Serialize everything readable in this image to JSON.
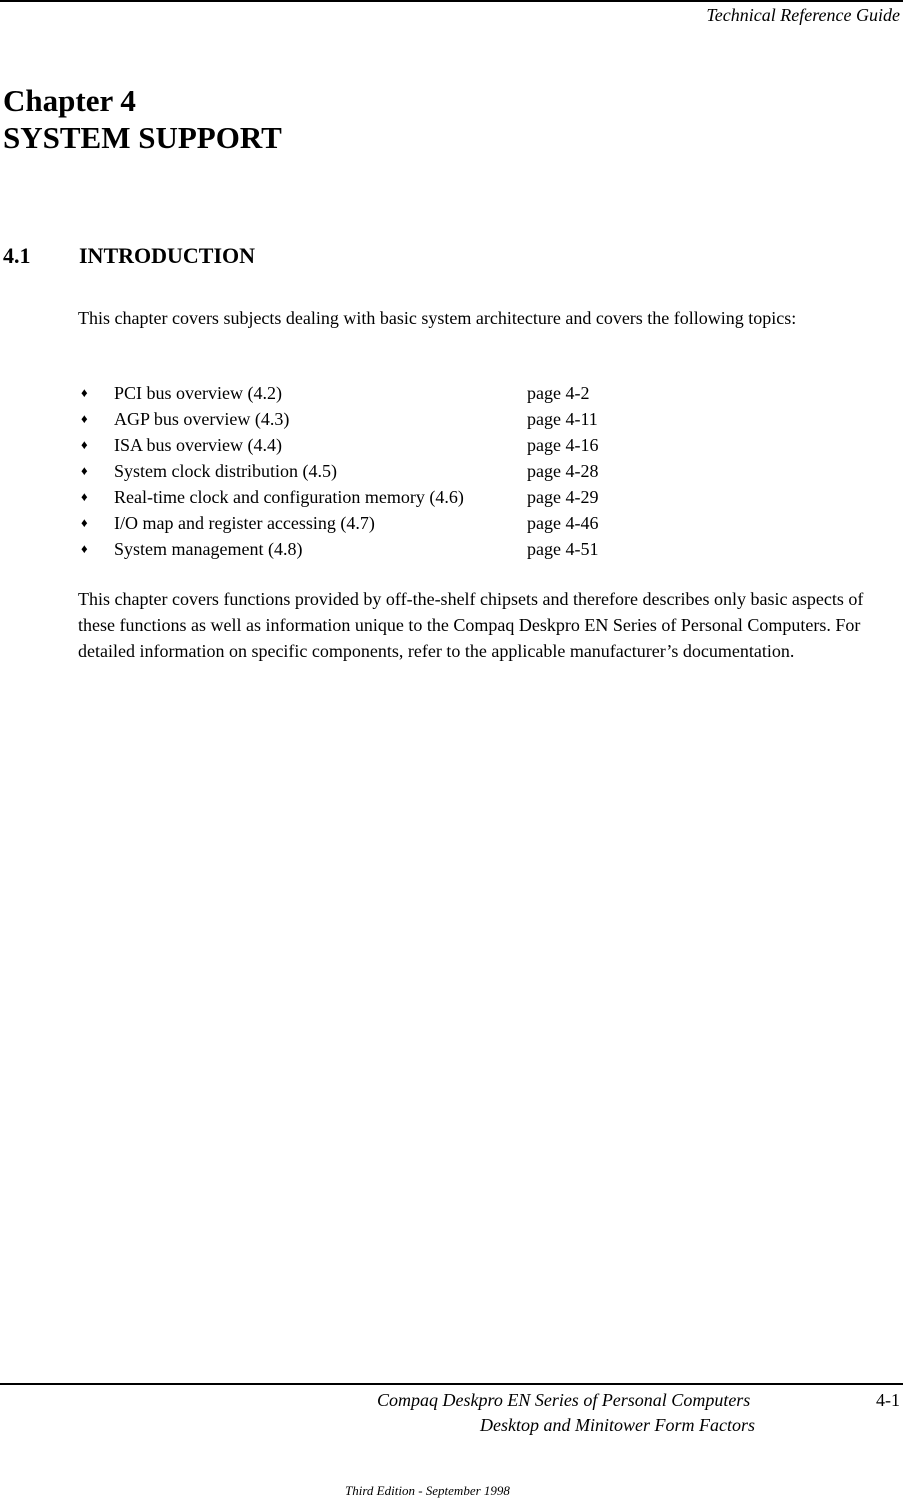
{
  "header": {
    "title": "Technical Reference Guide"
  },
  "chapter": {
    "line1": "Chapter 4",
    "line2": "SYSTEM SUPPORT"
  },
  "section": {
    "number": "4.1",
    "title": "INTRODUCTION",
    "intro": "This chapter covers subjects dealing with basic system architecture and covers the following topics:",
    "topics": [
      {
        "bullet": "♦",
        "label": "PCI bus overview (4.2)",
        "page": "page 4-2"
      },
      {
        "bullet": "♦",
        "label": "AGP bus overview (4.3)",
        "page": "page 4-11"
      },
      {
        "bullet": "♦",
        "label": "ISA bus overview (4.4)",
        "page": "page 4-16"
      },
      {
        "bullet": "♦",
        "label": "System clock distribution (4.5)",
        "page": "page 4-28"
      },
      {
        "bullet": "♦",
        "label": "Real-time clock and configuration memory (4.6)",
        "page": "page 4-29"
      },
      {
        "bullet": "♦",
        "label": "I/O map and register accessing (4.7)",
        "page": "page 4-46"
      },
      {
        "bullet": "♦",
        "label": "System management (4.8)",
        "page": "page 4-51"
      }
    ],
    "closing": "This chapter covers functions provided by off-the-shelf chipsets and therefore describes only basic aspects of these functions as well as information unique to the Compaq Deskpro EN Series of Personal Computers.  For detailed information on specific components, refer to the applicable manufacturer’s documentation."
  },
  "footer": {
    "line1": "Compaq Deskpro EN Series of Personal Computers",
    "line2": "Desktop and Minitower Form Factors",
    "page_number": "4-1",
    "edition": "Third Edition - September 1998"
  }
}
